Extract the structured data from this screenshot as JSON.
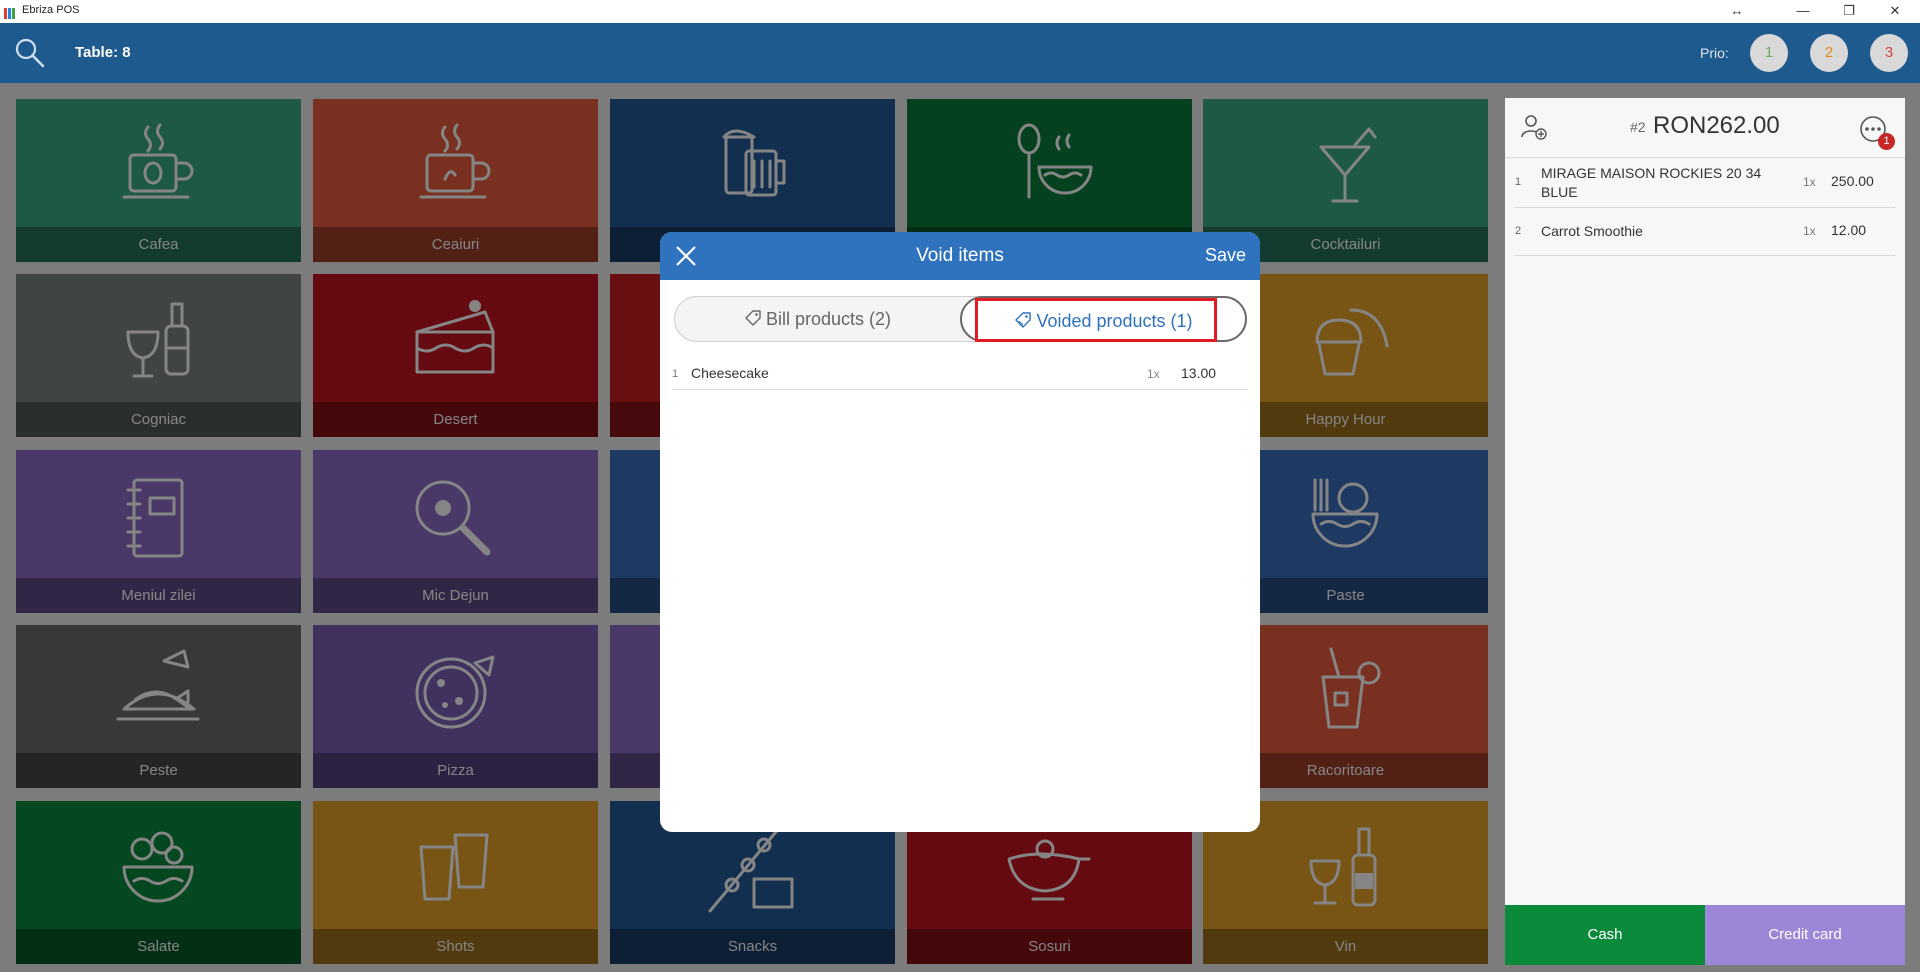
{
  "window": {
    "title": "Ebriza POS",
    "controls": [
      "↔",
      "—",
      "❐",
      "✕"
    ]
  },
  "header": {
    "table_label": "Table: 8",
    "prio_label": "Prio:",
    "prio_buttons": [
      {
        "label": "1",
        "color": "#6aaa64"
      },
      {
        "label": "2",
        "color": "#e08a1e"
      },
      {
        "label": "3",
        "color": "#d64541"
      }
    ]
  },
  "categories": [
    {
      "label": "Cafea",
      "color": "#3aa987",
      "icon": "coffee-cup-icon"
    },
    {
      "label": "Ceaiuri",
      "color": "#e85d3e",
      "icon": "tea-cup-icon"
    },
    {
      "label": "",
      "color": "#235b99",
      "icon": "beer-mugs-icon"
    },
    {
      "label": "",
      "color": "#0b7e3a",
      "icon": "soup-bowl-icon"
    },
    {
      "label": "Cocktailuri",
      "color": "#3aa987",
      "icon": "cocktail-icon"
    },
    {
      "label": "Cogniac",
      "color": "#7d8284",
      "icon": "cognac-bottle-icon"
    },
    {
      "label": "Desert",
      "color": "#c0151f",
      "icon": "cake-icon"
    },
    {
      "label": "",
      "color": "#c91e23",
      "icon": ""
    },
    {
      "label": "",
      "color": "#e0e0e0",
      "icon": ""
    },
    {
      "label": "Happy Hour",
      "color": "#e6a42a",
      "icon": "muffin-croissant-icon"
    },
    {
      "label": "Meniul zilei",
      "color": "#8e6dc7",
      "icon": "notebook-icon"
    },
    {
      "label": "Mic Dejun",
      "color": "#8e6dc7",
      "icon": "frying-pan-icon"
    },
    {
      "label": "",
      "color": "#3a6fbd",
      "icon": ""
    },
    {
      "label": "",
      "color": "#e0e0e0",
      "icon": ""
    },
    {
      "label": "Paste",
      "color": "#3a6fbd",
      "icon": "pasta-bowl-icon"
    },
    {
      "label": "Peste",
      "color": "#6b6b6b",
      "icon": "fish-plate-icon"
    },
    {
      "label": "Pizza",
      "color": "#7b5fb5",
      "icon": "pizza-icon"
    },
    {
      "label": "",
      "color": "#8e6dc7",
      "icon": ""
    },
    {
      "label": "",
      "color": "#e0e0e0",
      "icon": ""
    },
    {
      "label": "Racoritoare",
      "color": "#e85d3e",
      "icon": "soft-drink-icon"
    },
    {
      "label": "Salate",
      "color": "#0b8a3c",
      "icon": "salad-bowl-icon"
    },
    {
      "label": "Shots",
      "color": "#e6a42a",
      "icon": "shot-glasses-icon"
    },
    {
      "label": "Snacks",
      "color": "#235b99",
      "icon": "skewer-cheese-icon"
    },
    {
      "label": "Sosuri",
      "color": "#c0151f",
      "icon": "gravy-boat-icon"
    },
    {
      "label": "Vin",
      "color": "#e6a42a",
      "icon": "wine-bottle-icon"
    }
  ],
  "order": {
    "number": "#2",
    "total": "RON262.00",
    "badge": "1",
    "items": [
      {
        "idx": "1",
        "name": "MIRAGE MAISON ROCKIES 20 34 BLUE",
        "qty": "1x",
        "price": "250.00"
      },
      {
        "idx": "2",
        "name": "Carrot Smoothie",
        "qty": "1x",
        "price": "12.00"
      }
    ],
    "cash_label": "Cash",
    "card_label": "Credit card",
    "cash_color": "#0b8a3c",
    "card_color": "#9c86d8"
  },
  "modal": {
    "title": "Void items",
    "save_label": "Save",
    "tab_bill": "Bill products (2)",
    "tab_voided": "Voided products (1)",
    "voided_items": [
      {
        "idx": "1",
        "name": "Cheesecake",
        "qty": "1x",
        "price": "13.00"
      }
    ]
  }
}
